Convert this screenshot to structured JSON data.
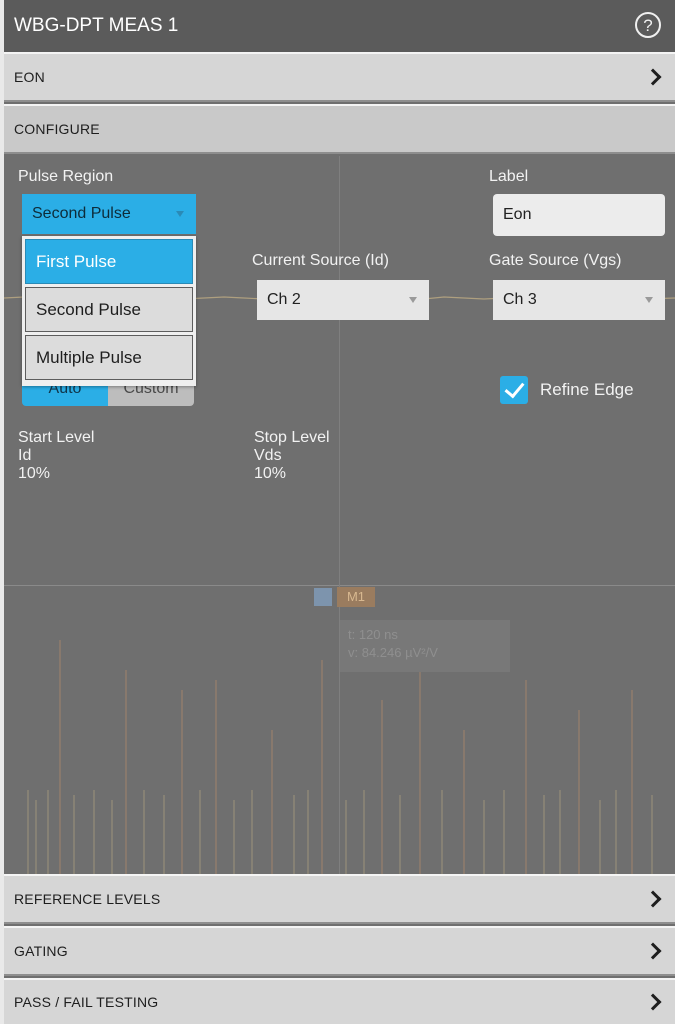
{
  "window": {
    "title": "WBG-DPT MEAS 1",
    "help_icon": "help-circle-icon",
    "help_glyph": "?"
  },
  "sections": {
    "eon": {
      "label": "EON"
    },
    "configure": {
      "label": "CONFIGURE"
    },
    "reference_levels": {
      "label": "REFERENCE LEVELS"
    },
    "gating": {
      "label": "GATING"
    },
    "pass_fail": {
      "label": "PASS / FAIL TESTING"
    }
  },
  "configure": {
    "pulse_region": {
      "label": "Pulse Region",
      "value": "Second Pulse"
    },
    "label_field": {
      "label": "Label",
      "value": "Eon"
    },
    "current_source": {
      "label": "Current Source (Id)",
      "value": "Ch 2"
    },
    "gate_source": {
      "label": "Gate Source (Vgs)",
      "value": "Ch 3"
    },
    "edge_mode": {
      "options": [
        "Auto",
        "Custom"
      ],
      "selected": "Auto"
    },
    "refine_edge": {
      "label": "Refine Edge",
      "checked": true
    },
    "start_level": {
      "title": "Start Level",
      "source": "Id",
      "value": "10%"
    },
    "stop_level": {
      "title": "Stop Level",
      "source": "Vds",
      "value": "10%"
    }
  },
  "dropdown": {
    "options": [
      "First Pulse",
      "Second Pulse",
      "Multiple Pulse"
    ],
    "highlighted": "First Pulse"
  },
  "background": {
    "marker_badge": "M1",
    "readout_line1": "t: 120 ns",
    "readout_line2": "v: 84.246 µV²/V"
  },
  "colors": {
    "accent": "#2baee6",
    "panel_bg": "#6f6f6f",
    "title_bar": "#5b5b5b",
    "section_bar": "#d6d6d6",
    "waveform": "#d8c08a"
  }
}
